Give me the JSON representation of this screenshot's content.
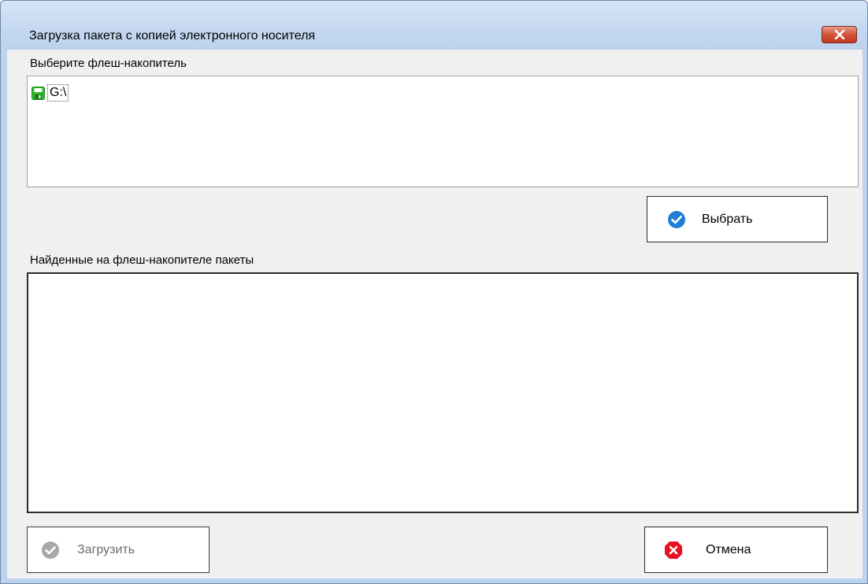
{
  "window": {
    "title": "Загрузка пакета с копией электронного носителя"
  },
  "drive_section": {
    "label": "Выберите флеш-накопитель",
    "items": [
      {
        "label": "G:\\",
        "icon": "floppy-disk-icon",
        "icon_color": "#2db82d"
      }
    ]
  },
  "select_button": {
    "label": "Выбрать",
    "icon": "checkmark-circle-icon",
    "icon_color": "#1e7fd6"
  },
  "packages_section": {
    "label": "Найденные на флеш-накопителе пакеты"
  },
  "load_button": {
    "label": "Загрузить",
    "icon": "checkmark-circle-icon",
    "icon_color": "#a8a8a8",
    "disabled": true
  },
  "cancel_button": {
    "label": "Отмена",
    "icon": "close-octagon-icon",
    "icon_color": "#e81123"
  }
}
